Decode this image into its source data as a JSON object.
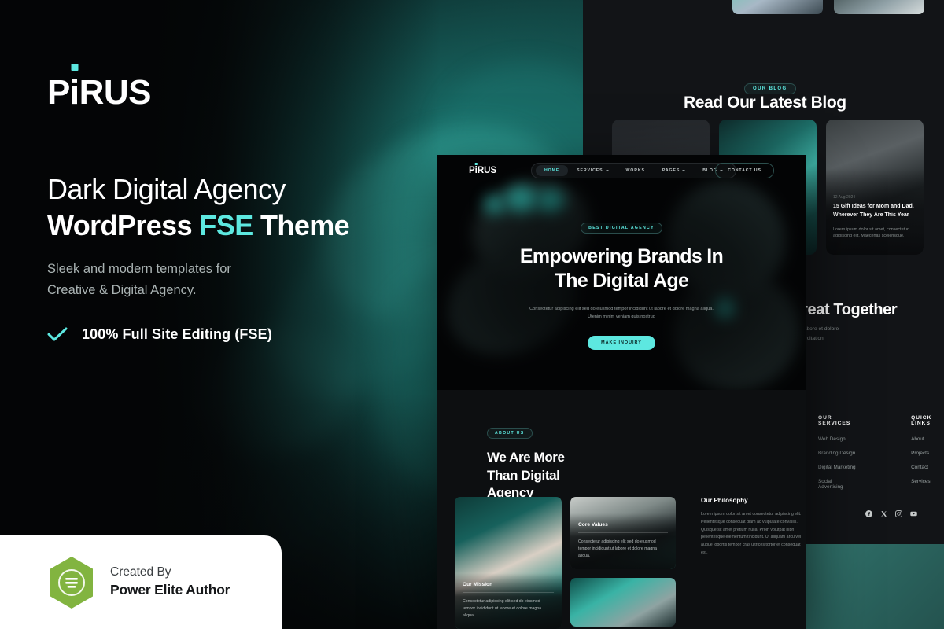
{
  "brand": {
    "name_part1": "P",
    "name_i": "i",
    "name_part2": "RUS",
    "full": "PiRUS"
  },
  "hero": {
    "headline_line1": "Dark Digital Agency",
    "headline_line2_a": "WordPress ",
    "headline_line2_accent": "FSE",
    "headline_line2_b": " Theme",
    "subtitle_line1": "Sleek and modern templates for",
    "subtitle_line2": "Creative & Digital Agency.",
    "feature": "100% Full Site Editing (FSE)"
  },
  "elite_badge": {
    "line1": "Created By",
    "line2": "Power Elite Author"
  },
  "colors": {
    "accent": "#5de8e0",
    "dark_bg": "#050607",
    "panel_bg": "#121417",
    "teal": "#2f6d67",
    "envato_green": "#82b440"
  },
  "mockup": {
    "nav": {
      "logo": "PiRUS",
      "items": [
        {
          "label": "HOME",
          "active": true,
          "caret": false
        },
        {
          "label": "SERVICES",
          "active": false,
          "caret": true
        },
        {
          "label": "WORKS",
          "active": false,
          "caret": false
        },
        {
          "label": "PAGES",
          "active": false,
          "caret": true
        },
        {
          "label": "BLOG",
          "active": false,
          "caret": true
        }
      ],
      "contact_button": "CONTACT US"
    },
    "hero": {
      "badge": "BEST DIGITAL AGENCY",
      "title_line1": "Empowering Brands In",
      "title_line2": "The Digital Age",
      "paragraph": "Consectetur adipiscing elit sed do eiusmod tempor incididunt ut labore et dolore magna aliqua. Utenim minim veniam quis nostrud",
      "cta": "MAKE INQUIRY"
    },
    "about": {
      "badge": "ABOUT US",
      "title_line1": "We Are More",
      "title_line2": "Than Digital",
      "title_line3": "Agency",
      "philosophy_title": "Our Philosophy",
      "philosophy_text": "Lorem ipsum dolor sit amet consectetur adipiscing elit. Pellentesque consequat diam ac vulputate convallis. Quisque sit amet pretium nulla. Proin volutpat nibh pellentesque elementum tincidunt. Ut aliquam arcu vel augue lobortis tempor cras ultrices tortor et consequat est.",
      "cards": [
        {
          "title": "Our Mission",
          "text": "Consectetur adipiscing elit sed do eiusmod tempor incididunt ut labore et dolore magna aliqua."
        },
        {
          "title": "Core Values",
          "text": "Consectetur adipiscing elit sed do eiusmod tempor incididunt ut labore et dolore magna aliqua."
        }
      ]
    }
  },
  "back_panel": {
    "blog": {
      "badge": "OUR BLOG",
      "title": "Read Our Latest Blog",
      "cards": [
        {
          "date": "",
          "title": "",
          "desc": ""
        },
        {
          "date": "",
          "title": "",
          "desc": ""
        },
        {
          "date": "12 Aug 2024",
          "title": "15 Gift Ideas for Mom and Dad, Wherever They Are This Year",
          "desc": "Lorem ipsum dolor sit amet, consectetur adipiscing elit. Maecenas scelerisque."
        }
      ]
    },
    "cta": {
      "title": "Great Together",
      "sub_line1": "ut labore et dolore",
      "sub_line2": "exercitation"
    },
    "footer": {
      "columns": [
        {
          "heading": "OUR SERVICES",
          "links": [
            "Web Design",
            "Branding Design",
            "Digital Marketing",
            "Social Advertising"
          ]
        },
        {
          "heading": "QUICK LINKS",
          "links": [
            "About",
            "Projects",
            "Contact",
            "Services"
          ]
        }
      ],
      "socials": [
        "facebook-icon",
        "x-twitter-icon",
        "instagram-icon",
        "youtube-icon"
      ]
    }
  }
}
